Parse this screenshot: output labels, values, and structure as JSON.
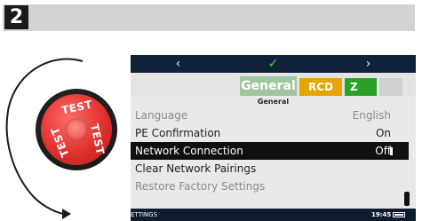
{
  "step": {
    "number": "2"
  },
  "knob": {
    "label_top": "TEST",
    "label_right": "TEST",
    "label_left": "TEST"
  },
  "toolbar": {
    "back_icon": "chevron-left",
    "ok_icon": "checkmark",
    "next_icon": "chevron-right"
  },
  "tabs": [
    {
      "label": "General",
      "color": "#9fc79e",
      "active": true
    },
    {
      "label": "RCD",
      "color": "#e8a400"
    },
    {
      "label": "Z",
      "color": "#2aa12a"
    },
    {
      "label": "",
      "color": "#d0d0d0"
    }
  ],
  "section_title": "General",
  "settings": [
    {
      "label": "Language",
      "value": "English",
      "enabled": false
    },
    {
      "label": "PE Confirmation",
      "value": "On",
      "enabled": true
    },
    {
      "label": "Network Connection",
      "value": "Off",
      "selected": true
    },
    {
      "label": "Clear Network Pairings",
      "value": "",
      "enabled": true
    },
    {
      "label": "Restore Factory Settings",
      "value": "",
      "enabled": false
    }
  ],
  "status": {
    "left": "ETTINGS",
    "time": "19:45"
  }
}
